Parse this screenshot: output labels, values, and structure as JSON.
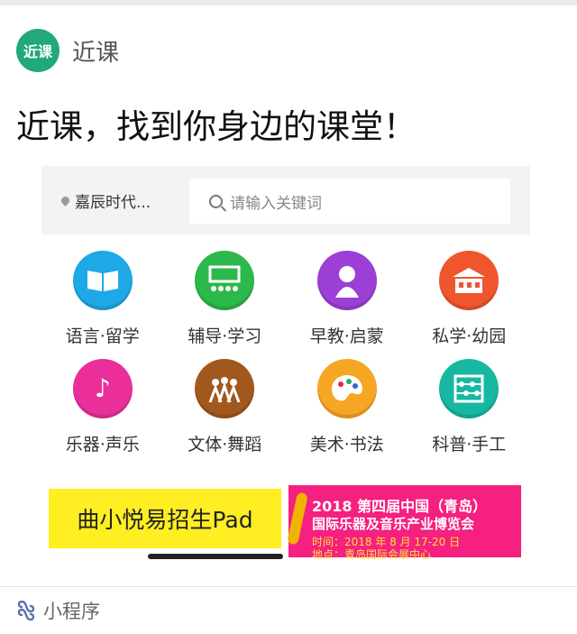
{
  "header": {
    "logo_text": "近课",
    "app_name": "近课"
  },
  "headline": "近课，找到你身边的课堂！",
  "search": {
    "location": "嘉辰时代...",
    "placeholder": "请输入关键词"
  },
  "categories": [
    {
      "label": "语言·留学",
      "icon": "book-icon",
      "color": "#1fa8e6"
    },
    {
      "label": "辅导·学习",
      "icon": "classroom-icon",
      "color": "#2cb84a"
    },
    {
      "label": "早教·启蒙",
      "icon": "child-icon",
      "color": "#9b3fd6"
    },
    {
      "label": "私学·幼园",
      "icon": "school-building-icon",
      "color": "#f0562e"
    },
    {
      "label": "乐器·声乐",
      "icon": "music-icon",
      "color": "#ea2f9b"
    },
    {
      "label": "文体·舞蹈",
      "icon": "dance-icon",
      "color": "#a0581d"
    },
    {
      "label": "美术·书法",
      "icon": "palette-icon",
      "color": "#f5a623"
    },
    {
      "label": "科普·手工",
      "icon": "abacus-icon",
      "color": "#17b8a2"
    }
  ],
  "banners": {
    "left": "曲小悦易招生Pad",
    "right_title": "2018 第四届中国（青岛）",
    "right_subtitle": "国际乐器及音乐产业博览会",
    "right_date": "时间：2018 年 8 月 17-20 日",
    "right_place": "地点：青岛国际会展中心"
  },
  "footer": {
    "label": "小程序",
    "icon": "mini-program-icon"
  }
}
